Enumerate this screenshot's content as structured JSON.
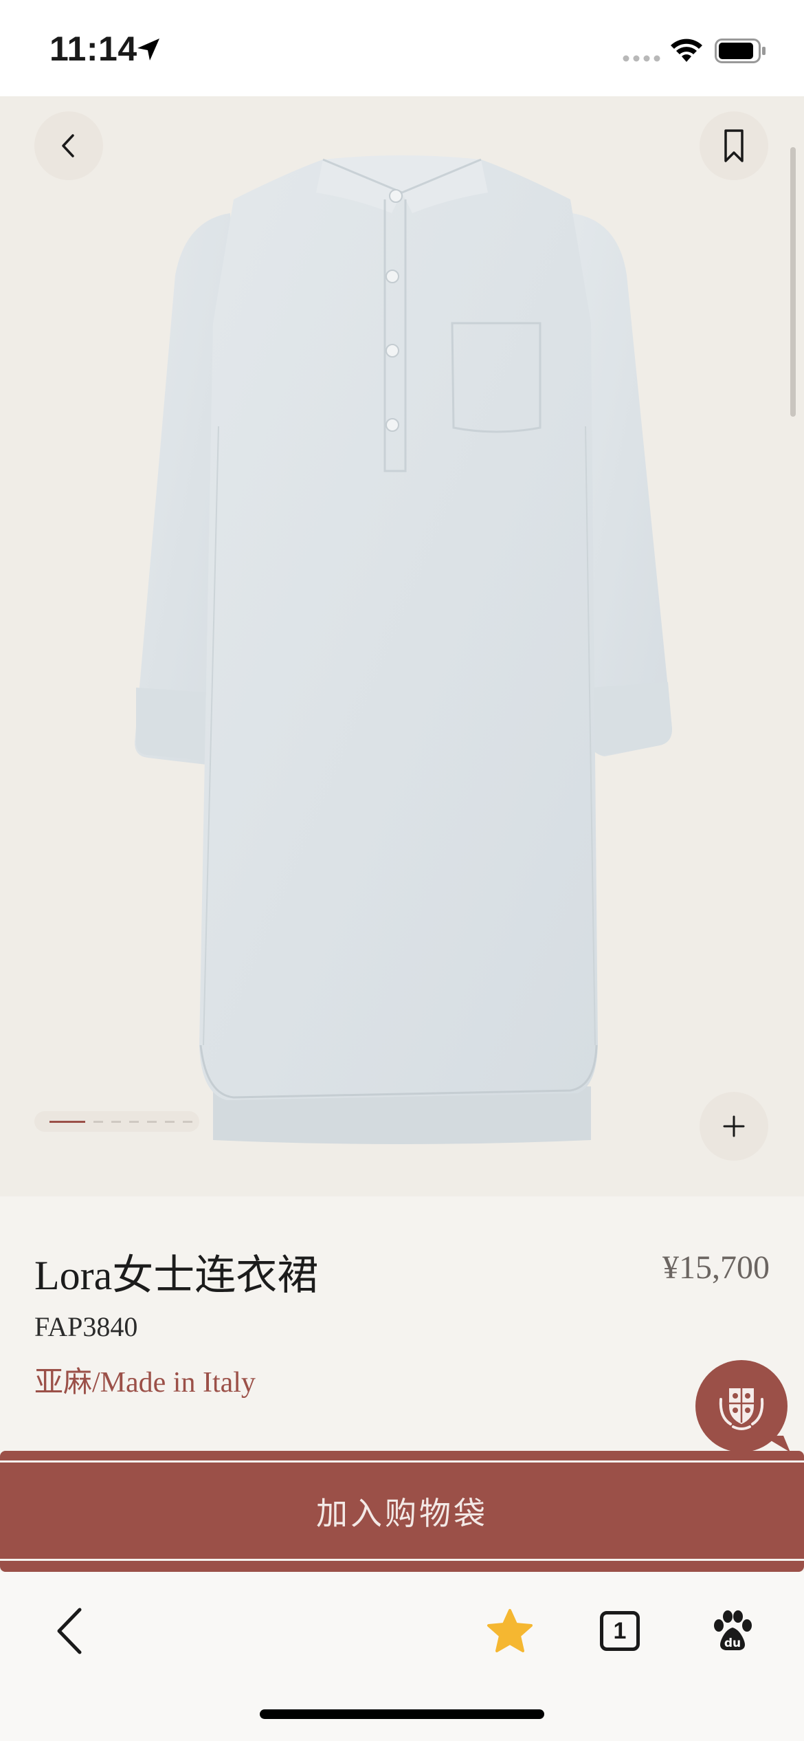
{
  "status_bar": {
    "time": "11:14"
  },
  "colors": {
    "accent": "#9b5048",
    "background": "#f5f3ef",
    "hero_background": "#f0ede7",
    "dress": "#dde3e7",
    "star": "#f5b731"
  },
  "gallery": {
    "image_count": 7,
    "current_index": 1
  },
  "product": {
    "name": "Lora女士连衣裙",
    "price": "¥15,700",
    "sku": "FAP3840",
    "material": "亚麻/Made in Italy"
  },
  "cta": {
    "label": "加入购物袋"
  },
  "toolbar": {
    "tab_count": "1"
  },
  "icons": {
    "back": "chevron-left-icon",
    "bookmark": "bookmark-icon",
    "zoom": "plus-icon",
    "chat": "crest-chat-icon",
    "favorite": "star-icon",
    "tabs": "tabs-icon",
    "baidu": "baidu-paw-icon"
  }
}
